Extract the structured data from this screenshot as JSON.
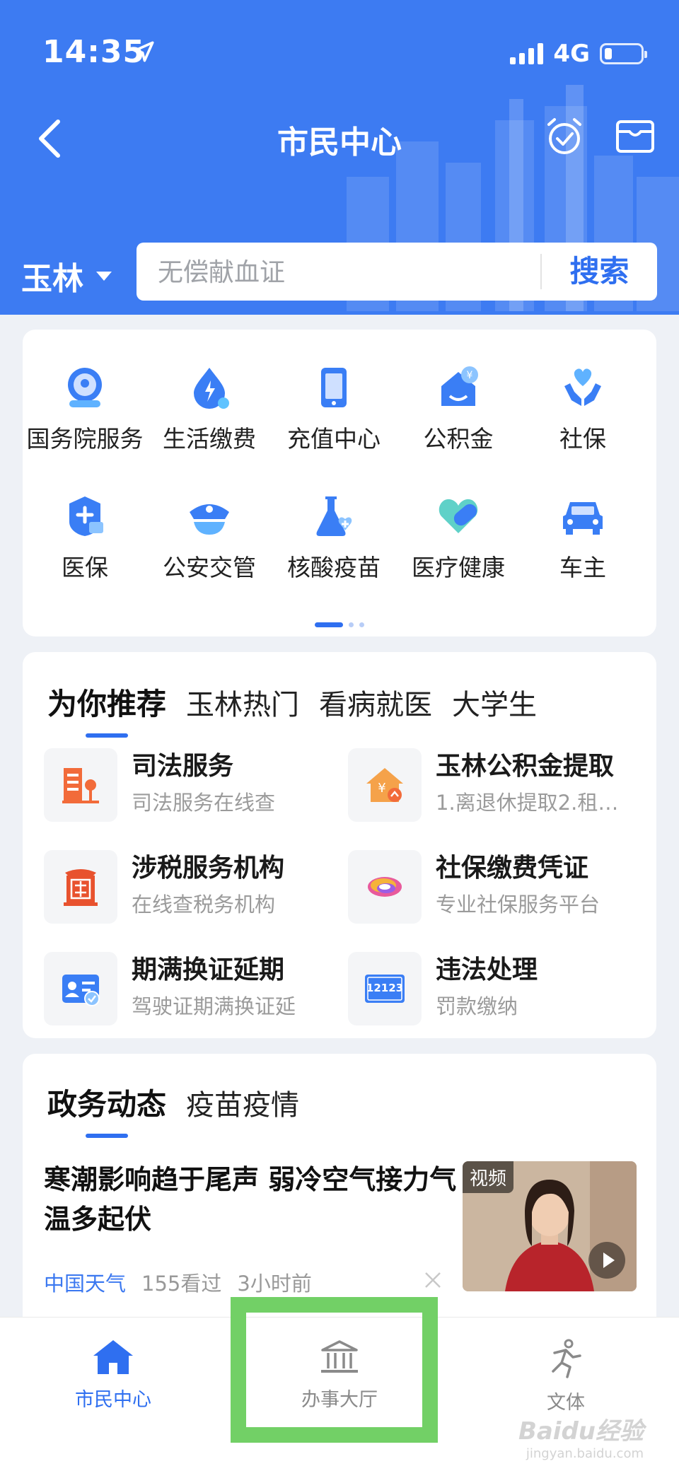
{
  "status_bar": {
    "time": "14:35",
    "network": "4G"
  },
  "header": {
    "title": "市民中心",
    "city": "玉林"
  },
  "search": {
    "placeholder": "无偿献血证",
    "button": "搜索"
  },
  "services_grid": [
    {
      "label": "国务院服务",
      "icon": "state-council-icon"
    },
    {
      "label": "生活缴费",
      "icon": "utility-bill-icon"
    },
    {
      "label": "充值中心",
      "icon": "phone-topup-icon"
    },
    {
      "label": "公积金",
      "icon": "housing-fund-icon"
    },
    {
      "label": "社保",
      "icon": "social-security-icon"
    },
    {
      "label": "医保",
      "icon": "medical-insurance-icon"
    },
    {
      "label": "公安交管",
      "icon": "police-traffic-icon"
    },
    {
      "label": "核酸疫苗",
      "icon": "nucleic-vaccine-icon"
    },
    {
      "label": "医疗健康",
      "icon": "medical-health-icon"
    },
    {
      "label": "车主",
      "icon": "car-owner-icon"
    }
  ],
  "recommend": {
    "tabs": [
      "为你推荐",
      "玉林热门",
      "看病就医",
      "大学生"
    ],
    "items": [
      {
        "title": "司法服务",
        "subtitle": "司法服务在线查",
        "icon": "justice-building-icon"
      },
      {
        "title": "玉林公积金提取",
        "subtitle": "1.离退休提取2.租…",
        "icon": "fund-house-icon"
      },
      {
        "title": "涉税服务机构",
        "subtitle": "在线查税务机构",
        "icon": "tax-office-icon"
      },
      {
        "title": "社保缴费凭证",
        "subtitle": "专业社保服务平台",
        "icon": "social-security-logo-icon"
      },
      {
        "title": "期满换证延期",
        "subtitle": "驾驶证期满换证延",
        "icon": "license-renew-icon"
      },
      {
        "title": "违法处理",
        "subtitle": "罚款缴纳",
        "icon": "traffic-12123-icon"
      }
    ]
  },
  "news": {
    "tabs": [
      "政务动态",
      "疫苗疫情"
    ],
    "article": {
      "title": "寒潮影响趋于尾声 弱冷空气接力气温多起伏",
      "source": "中国天气",
      "views": "155看过",
      "time": "3小时前",
      "badge": "视频"
    }
  },
  "bottom_nav": [
    {
      "label": "市民中心",
      "active": true
    },
    {
      "label": "办事大厅",
      "active": false
    },
    {
      "label": "文体",
      "active": false
    }
  ],
  "watermark": {
    "text": "Baidu经验",
    "sub": "jingyan.baidu.com"
  },
  "colors": {
    "primary": "#3d7bf2",
    "accent": "#2f6ff0",
    "highlight": "#72d066"
  }
}
